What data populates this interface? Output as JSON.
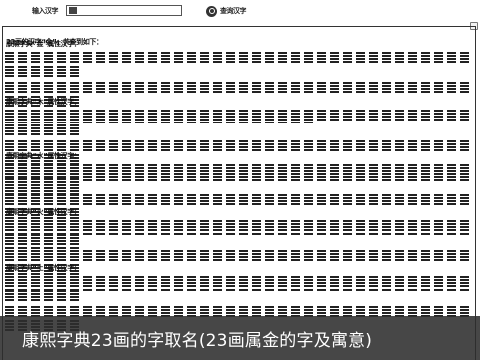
{
  "toolbar": {
    "input_label": "输入汉字",
    "input_value": "",
    "search_button_label": "查询汉字"
  },
  "results": {
    "title": "23画的汉字“金”，共查到如下：",
    "sections": [
      {
        "heading": "康熙字典“金”属性汉字：",
        "row_counts": [
          42,
          42,
          24
        ],
        "chars": ""
      },
      {
        "heading": "康熙字典“木”属性汉字：",
        "row_counts": [
          42,
          42,
          42
        ],
        "chars": ""
      },
      {
        "heading": "康熙字典“水”属性汉字：",
        "row_counts": [
          42,
          42,
          42
        ],
        "chars": ""
      },
      {
        "heading": "康熙字典“火”属性汉字：",
        "row_counts": [
          42,
          42,
          36
        ],
        "chars": ""
      },
      {
        "heading": "康熙字典“土”属性汉字：",
        "row_counts": [
          42,
          42
        ],
        "chars": ""
      }
    ]
  },
  "banner": {
    "text": "康熙字典23画的字取名(23画属金的字及寓意)",
    "color": "#2e2e2e"
  }
}
